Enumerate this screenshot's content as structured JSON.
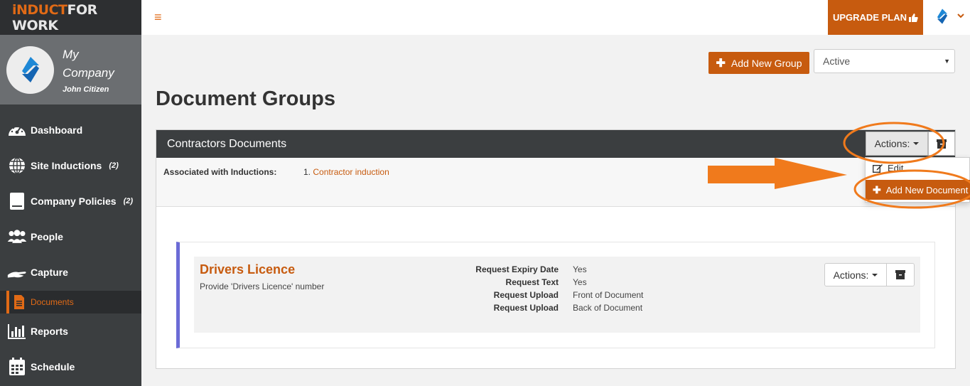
{
  "brand": {
    "part1": "iNDUCT",
    "part2": "FOR WORK"
  },
  "profile": {
    "company": "My Company",
    "user": "John Citizen"
  },
  "nav": [
    {
      "label": "Dashboard",
      "icon": "dashboard-icon",
      "count": ""
    },
    {
      "label": "Site Inductions",
      "icon": "globe-icon",
      "count": "(2)"
    },
    {
      "label": "Company Policies",
      "icon": "book-icon",
      "count": "(2)"
    },
    {
      "label": "People",
      "icon": "people-icon",
      "count": ""
    },
    {
      "label": "Capture",
      "icon": "hand-icon",
      "count": ""
    },
    {
      "label": "Reports",
      "icon": "bar-chart-icon",
      "count": ""
    },
    {
      "label": "Schedule",
      "icon": "calendar-icon",
      "count": ""
    }
  ],
  "nav_sub": {
    "label": "Documents",
    "icon": "document-icon"
  },
  "topbar": {
    "menu": "≡",
    "upgrade": "UPGRADE PLAN",
    "caret": "⌄"
  },
  "toolbar": {
    "add_group": "Add New Group",
    "status": "Active"
  },
  "page_title": "Document Groups",
  "group": {
    "title": "Contractors Documents",
    "actions": "Actions:",
    "assoc_label": "Associated with Inductions:",
    "assoc_num": "1.",
    "assoc_link": "Contractor induction"
  },
  "dropdown": {
    "edit": "Edit",
    "add": "Add New Document"
  },
  "document": {
    "title": "Drivers Licence",
    "desc": "Provide 'Drivers Licence' number",
    "actions": "Actions:",
    "props": [
      {
        "k": "Request Expiry Date",
        "v": "Yes"
      },
      {
        "k": "Request Text",
        "v": "Yes"
      },
      {
        "k": "Request Upload",
        "v": "Front of Document"
      },
      {
        "k": "Request Upload",
        "v": "Back of Document"
      }
    ]
  },
  "colors": {
    "accent": "#c75b0f",
    "sidebar": "#3b3e40",
    "annotation": "#f07a1c",
    "doc_border": "#6b6bd6"
  }
}
